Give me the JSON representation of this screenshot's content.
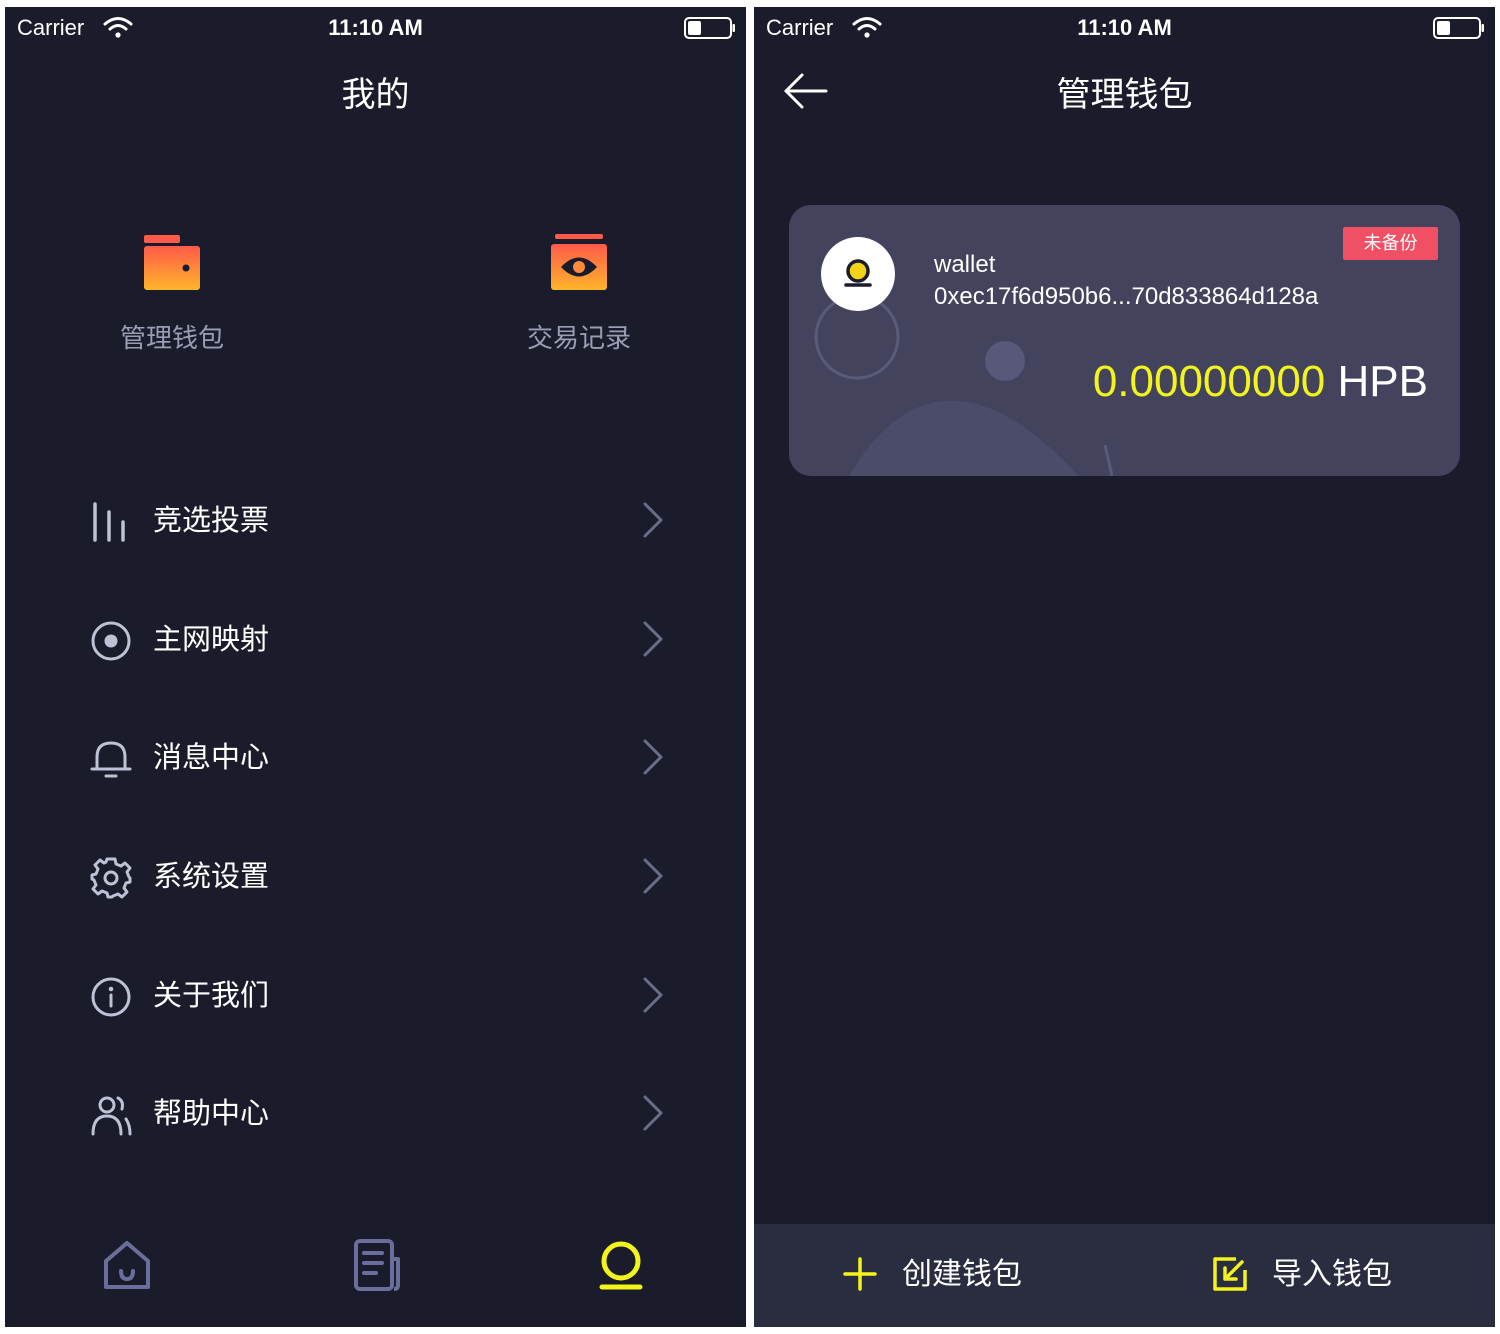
{
  "status_bar": {
    "carrier": "Carrier",
    "time": "11:10 AM"
  },
  "profile_screen": {
    "title": "我的",
    "quick_actions": [
      {
        "label": "管理钱包",
        "icon": "wallet-icon"
      },
      {
        "label": "交易记录",
        "icon": "money-icon"
      }
    ],
    "menu": [
      {
        "label": "竞选投票",
        "icon": "vote-bars-icon"
      },
      {
        "label": "主网映射",
        "icon": "target-icon"
      },
      {
        "label": "消息中心",
        "icon": "bell-icon"
      },
      {
        "label": "系统设置",
        "icon": "gear-icon"
      },
      {
        "label": "关于我们",
        "icon": "info-icon"
      },
      {
        "label": "帮助中心",
        "icon": "users-icon"
      }
    ],
    "tabbar": [
      {
        "icon": "home-icon",
        "active": false
      },
      {
        "icon": "document-icon",
        "active": false
      },
      {
        "icon": "profile-icon",
        "active": true
      }
    ]
  },
  "wallet_screen": {
    "title": "管理钱包",
    "card": {
      "name": "wallet",
      "address": "0xec17f6d950b6...70d833864d128a",
      "badge": "未备份",
      "balance_amount": "0.00000000",
      "balance_unit": "HPB"
    },
    "bottom": {
      "create_label": "创建钱包",
      "import_label": "导入钱包"
    }
  },
  "colors": {
    "background": "#1a1c2b",
    "card": "#43435e",
    "accent": "#f3f51a",
    "badge": "#f04f64",
    "muted": "#9b9db5"
  }
}
